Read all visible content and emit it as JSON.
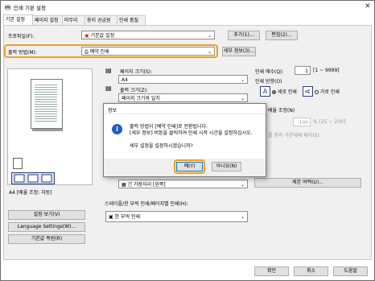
{
  "window": {
    "title": "인쇄 기본 설정"
  },
  "tabs": [
    {
      "label": "기본 설정"
    },
    {
      "label": "페이지 설정"
    },
    {
      "label": "마무리"
    },
    {
      "label": "용지 공급원"
    },
    {
      "label": "인쇄 품질"
    }
  ],
  "profile": {
    "label": "프로파일(F):",
    "value": "기본값 설정",
    "add_label": "추가(1)...",
    "edit_label": "편집(2)..."
  },
  "output": {
    "label": "출력 방법(M):",
    "value": "예약 인쇄",
    "details_label": "세부 정보(3)..."
  },
  "page_size": {
    "label": "페이지 크기(S):",
    "value": "A4"
  },
  "output_size": {
    "label": "출력 크기(Z):",
    "value": "페이지 크기와 일치"
  },
  "copies": {
    "label": "인쇄 매수(Q):",
    "value": "1",
    "range": "[1 ~ 9999]"
  },
  "orientation": {
    "label": "인쇄 방향(O)",
    "portrait": "세로 인쇄",
    "landscape": "가로 인쇄"
  },
  "scaling": {
    "label": "배율 조정(N)",
    "value": "100",
    "range": "% [25 ~ 200]",
    "note": "를 용지 가운데에 배치(5)"
  },
  "preview": {
    "caption": "A4 [배율 조정: 자동]"
  },
  "binding": {
    "value": "긴 가장자리 [왼쪽]",
    "margin_label": "제본 여백(U)..."
  },
  "duplex": {
    "label": "스테이플/한 부씩 인쇄/페이지별 인쇄(H):",
    "value": "한 부씩 인쇄"
  },
  "left_buttons": {
    "view_settings": "설정 보기(V)",
    "language": "Language Settings(W)...",
    "restore": "기본값 복원(R)"
  },
  "footer": {
    "ok": "확인",
    "cancel": "취소",
    "help": "도움말"
  },
  "dialog": {
    "title": "정보",
    "message": "출력 방법이 [예약 인쇄]로 전환됩니다.\n[세부 정보] 버튼을 클릭하여 인쇄 시작 시간을 설정하십시오.",
    "question": "세부 설정을 설정하시겠습니까?",
    "yes": "예(Y)",
    "no": "아니요(N)",
    "icon": "info-icon"
  }
}
